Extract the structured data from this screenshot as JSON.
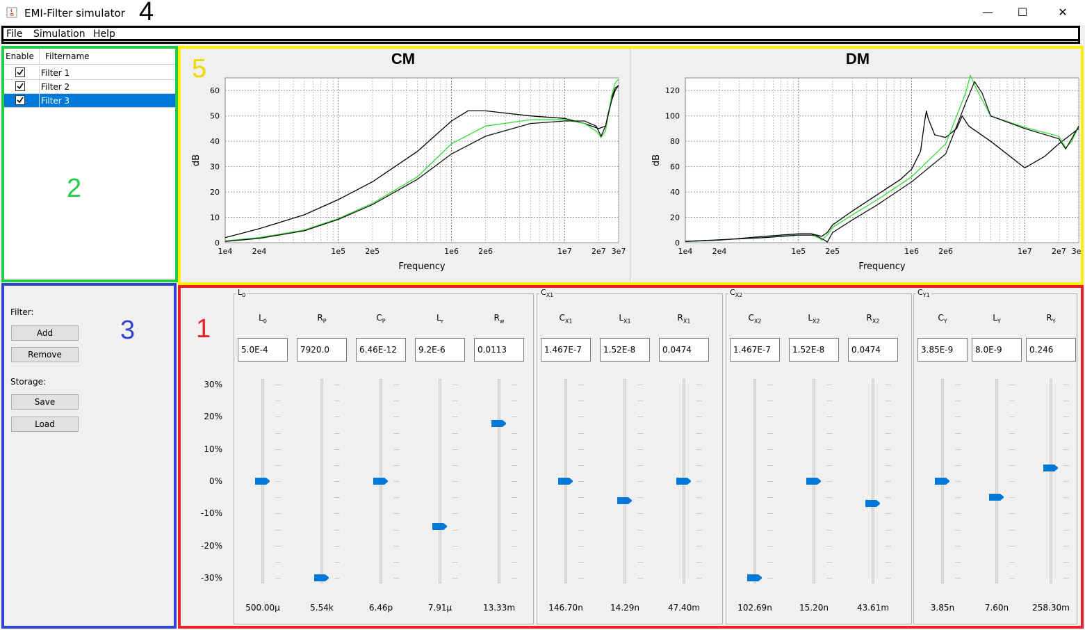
{
  "window": {
    "title": "EMI-Filter simulator",
    "controls": {
      "minimize": "—",
      "maximize": "☐",
      "close": "✕"
    }
  },
  "annotations": {
    "n1": "1",
    "n2": "2",
    "n3": "3",
    "n4": "4",
    "n5": "5"
  },
  "menu": [
    "File",
    "Simulation",
    "Help"
  ],
  "filter_table": {
    "headers": {
      "enable": "Enable",
      "name": "Filtername"
    },
    "rows": [
      {
        "name": "Filter 1",
        "enabled": true,
        "selected": false
      },
      {
        "name": "Filter 2",
        "enabled": true,
        "selected": false
      },
      {
        "name": "Filter 3",
        "enabled": true,
        "selected": true
      }
    ]
  },
  "side_panel": {
    "filter_label": "Filter:",
    "add": "Add",
    "remove": "Remove",
    "storage_label": "Storage:",
    "save": "Save",
    "load": "Load"
  },
  "chart_data": [
    {
      "type": "line",
      "title": "CM",
      "xlabel": "Frequency",
      "ylabel": "dB",
      "x_scale": "log",
      "xlim": [
        10000,
        30000000
      ],
      "ylim": [
        0,
        65
      ],
      "x_ticks": [
        [
          10000,
          "1e4"
        ],
        [
          20000,
          "2e4"
        ],
        [
          100000,
          "1e5"
        ],
        [
          200000,
          "2e5"
        ],
        [
          1000000,
          "1e6"
        ],
        [
          2000000,
          "2e6"
        ],
        [
          10000000,
          "1e7"
        ],
        [
          20000000,
          "2e7"
        ],
        [
          30000000,
          "3e7"
        ]
      ],
      "y_ticks": [
        0,
        10,
        20,
        30,
        40,
        50,
        60
      ],
      "grid": true,
      "series": [
        {
          "color": "#000000",
          "points": [
            [
              10000,
              2
            ],
            [
              20000,
              5.5
            ],
            [
              50000,
              11
            ],
            [
              100000,
              17
            ],
            [
              200000,
              24
            ],
            [
              500000,
              36
            ],
            [
              1000000,
              48
            ],
            [
              1400000,
              52
            ],
            [
              2000000,
              52
            ],
            [
              5000000,
              50
            ],
            [
              10000000,
              49
            ],
            [
              15000000,
              47
            ],
            [
              20000000,
              45
            ],
            [
              23000000,
              46
            ],
            [
              26000000,
              57
            ],
            [
              28000000,
              61
            ],
            [
              30000000,
              62
            ]
          ]
        },
        {
          "color": "#33dd33",
          "points": [
            [
              10000,
              0.7
            ],
            [
              20000,
              2
            ],
            [
              50000,
              5
            ],
            [
              100000,
              9.5
            ],
            [
              200000,
              15.5
            ],
            [
              500000,
              26
            ],
            [
              1000000,
              39
            ],
            [
              2000000,
              46
            ],
            [
              5000000,
              48.5
            ],
            [
              10000000,
              48.5
            ],
            [
              15000000,
              47
            ],
            [
              19000000,
              44
            ],
            [
              21000000,
              41.5
            ],
            [
              23000000,
              44
            ],
            [
              26000000,
              58
            ],
            [
              28000000,
              63
            ],
            [
              30000000,
              64.5
            ]
          ]
        },
        {
          "color": "#111111",
          "points": [
            [
              10000,
              0.5
            ],
            [
              20000,
              1.7
            ],
            [
              50000,
              4.7
            ],
            [
              100000,
              9.2
            ],
            [
              200000,
              15
            ],
            [
              500000,
              25
            ],
            [
              1000000,
              35
            ],
            [
              2000000,
              42
            ],
            [
              5000000,
              47
            ],
            [
              10000000,
              48
            ],
            [
              15000000,
              48
            ],
            [
              19000000,
              46
            ],
            [
              21000000,
              42
            ],
            [
              23000000,
              46
            ],
            [
              26000000,
              56
            ],
            [
              28000000,
              60
            ],
            [
              30000000,
              62
            ]
          ]
        }
      ]
    },
    {
      "type": "line",
      "title": "DM",
      "xlabel": "Frequency",
      "ylabel": "dB",
      "x_scale": "log",
      "xlim": [
        10000,
        30000000
      ],
      "ylim": [
        0,
        130
      ],
      "x_ticks": [
        [
          10000,
          "1e4"
        ],
        [
          20000,
          "2e4"
        ],
        [
          100000,
          "1e5"
        ],
        [
          200000,
          "2e5"
        ],
        [
          1000000,
          "1e6"
        ],
        [
          2000000,
          "2e6"
        ],
        [
          10000000,
          "1e7"
        ],
        [
          20000000,
          "2e7"
        ],
        [
          30000000,
          "3e7"
        ]
      ],
      "y_ticks": [
        0,
        20,
        40,
        60,
        80,
        100,
        120
      ],
      "grid": true,
      "series": [
        {
          "color": "#000000",
          "points": [
            [
              10000,
              1
            ],
            [
              20000,
              2
            ],
            [
              50000,
              5
            ],
            [
              100000,
              7
            ],
            [
              130000,
              7
            ],
            [
              160000,
              5
            ],
            [
              180000,
              8
            ],
            [
              200000,
              14
            ],
            [
              300000,
              25
            ],
            [
              500000,
              38
            ],
            [
              800000,
              50
            ],
            [
              1000000,
              58
            ],
            [
              1200000,
              72
            ],
            [
              1300000,
              95
            ],
            [
              1350000,
              104
            ],
            [
              1400000,
              98
            ],
            [
              1600000,
              85
            ],
            [
              2000000,
              83
            ],
            [
              2500000,
              90
            ],
            [
              2800000,
              100
            ],
            [
              3200000,
              92
            ],
            [
              5000000,
              80
            ],
            [
              10000000,
              59
            ],
            [
              15000000,
              68
            ],
            [
              20000000,
              78
            ],
            [
              30000000,
              90
            ]
          ]
        },
        {
          "color": "#33dd33",
          "points": [
            [
              10000,
              1
            ],
            [
              50000,
              4
            ],
            [
              100000,
              6
            ],
            [
              130000,
              6
            ],
            [
              150000,
              4
            ],
            [
              160000,
              2
            ],
            [
              180000,
              6
            ],
            [
              200000,
              12
            ],
            [
              300000,
              22
            ],
            [
              500000,
              34
            ],
            [
              1000000,
              52
            ],
            [
              2000000,
              78
            ],
            [
              3000000,
              118
            ],
            [
              3300000,
              132
            ],
            [
              3800000,
              120
            ],
            [
              5000000,
              100
            ],
            [
              10000000,
              91
            ],
            [
              20000000,
              84
            ],
            [
              23000000,
              75
            ],
            [
              26000000,
              80
            ],
            [
              30000000,
              92
            ]
          ]
        },
        {
          "color": "#111111",
          "points": [
            [
              10000,
              1
            ],
            [
              50000,
              4
            ],
            [
              100000,
              6
            ],
            [
              140000,
              6
            ],
            [
              170000,
              2
            ],
            [
              180000,
              0.5
            ],
            [
              200000,
              8
            ],
            [
              300000,
              18
            ],
            [
              500000,
              30
            ],
            [
              1000000,
              48
            ],
            [
              2000000,
              70
            ],
            [
              3000000,
              110
            ],
            [
              3600000,
              127
            ],
            [
              4200000,
              118
            ],
            [
              5000000,
              100
            ],
            [
              10000000,
              90
            ],
            [
              20000000,
              82
            ],
            [
              23000000,
              74
            ],
            [
              26000000,
              82
            ],
            [
              30000000,
              92
            ]
          ]
        }
      ]
    }
  ],
  "slider_axis": [
    "30%",
    "20%",
    "10%",
    "0%",
    "-10%",
    "-20%",
    "-30%"
  ],
  "groups": [
    {
      "title": "L",
      "sub": "0",
      "params": [
        {
          "name": "L",
          "sub": "0",
          "field": "5.0E-4",
          "value": "500.00µ",
          "level": 0
        },
        {
          "name": "R",
          "sub": "P",
          "field": "7920.0",
          "value": "5.54k",
          "level": -30
        },
        {
          "name": "C",
          "sub": "P",
          "field": "6.46E-12",
          "value": "6.46p",
          "level": 0
        },
        {
          "name": "L",
          "sub": "r",
          "field": "9.2E-6",
          "value": "7.91µ",
          "level": -14
        },
        {
          "name": "R",
          "sub": "w",
          "field": "0.0113",
          "value": "13.33m",
          "level": 18
        }
      ]
    },
    {
      "title": "C",
      "sub": "X1",
      "params": [
        {
          "name": "C",
          "sub": "X1",
          "field": "1.467E-7",
          "value": "146.70n",
          "level": 0
        },
        {
          "name": "L",
          "sub": "X1",
          "field": "1.52E-8",
          "value": "14.29n",
          "level": -6
        },
        {
          "name": "R",
          "sub": "X1",
          "field": "0.0474",
          "value": "47.40m",
          "level": 0
        }
      ]
    },
    {
      "title": "C",
      "sub": "X2",
      "params": [
        {
          "name": "C",
          "sub": "X2",
          "field": "1.467E-7",
          "value": "102.69n",
          "level": -30
        },
        {
          "name": "L",
          "sub": "X2",
          "field": "1.52E-8",
          "value": "15.20n",
          "level": 0
        },
        {
          "name": "R",
          "sub": "X2",
          "field": "0.0474",
          "value": "43.61m",
          "level": -7
        }
      ]
    },
    {
      "title": "C",
      "sub": "Y1",
      "params": [
        {
          "name": "C",
          "sub": "Y",
          "field": "3.85E-9",
          "value": "3.85n",
          "level": 0
        },
        {
          "name": "L",
          "sub": "Y",
          "field": "8.0E-9",
          "value": "7.60n",
          "level": -5
        },
        {
          "name": "R",
          "sub": "Y",
          "field": "0.246",
          "value": "258.30m",
          "level": 4
        }
      ]
    }
  ],
  "colors": {
    "accent": "#0078d7",
    "frame1": "#e8202a",
    "frame2": "#22cc44",
    "frame3": "#3344cc",
    "frame4": "#000000",
    "frame5": "#ffee00"
  }
}
